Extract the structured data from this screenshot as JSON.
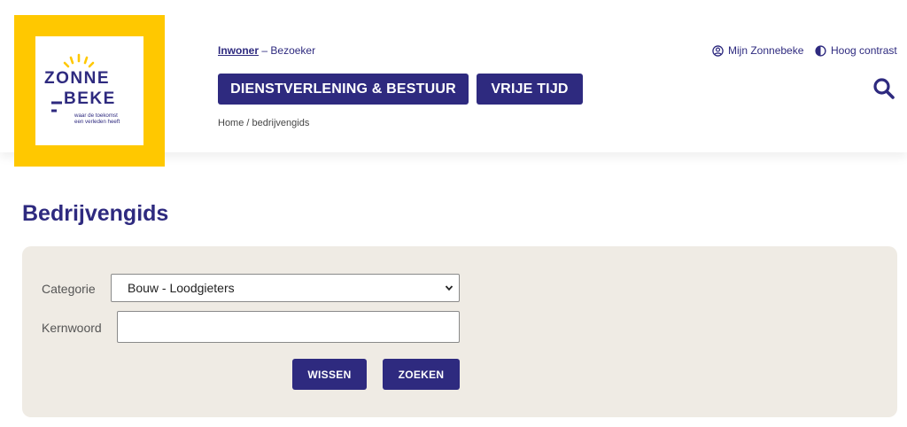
{
  "logo": {
    "word1": "ZONNE",
    "word2": "BEKE",
    "tagline1": "waar de toekomst",
    "tagline2": "een verleden heeft",
    "colors": {
      "frame": "#ffc800",
      "text": "#2e2a7f"
    }
  },
  "audience": {
    "active": "Inwoner",
    "separator": "–",
    "other": "Bezoeker"
  },
  "utility": {
    "account_label": "Mijn Zonnebeke",
    "account_icon": "user-circle-icon",
    "contrast_label": "Hoog contrast",
    "contrast_icon": "contrast-icon"
  },
  "nav": {
    "items": [
      {
        "label": "DIENSTVERLENING & BESTUUR"
      },
      {
        "label": "VRIJE TIJD"
      }
    ],
    "search_icon": "search-icon"
  },
  "breadcrumb": "Home / bedrijvengids",
  "page": {
    "title": "Bedrijvengids"
  },
  "filters": {
    "category_label": "Categorie",
    "category_value": "Bouw - Loodgieters",
    "keyword_label": "Kernwoord",
    "keyword_value": "",
    "clear_label": "WISSEN",
    "search_label": "ZOEKEN"
  },
  "theme": {
    "primary": "#2e2a7f",
    "panel": "#efebe4"
  }
}
